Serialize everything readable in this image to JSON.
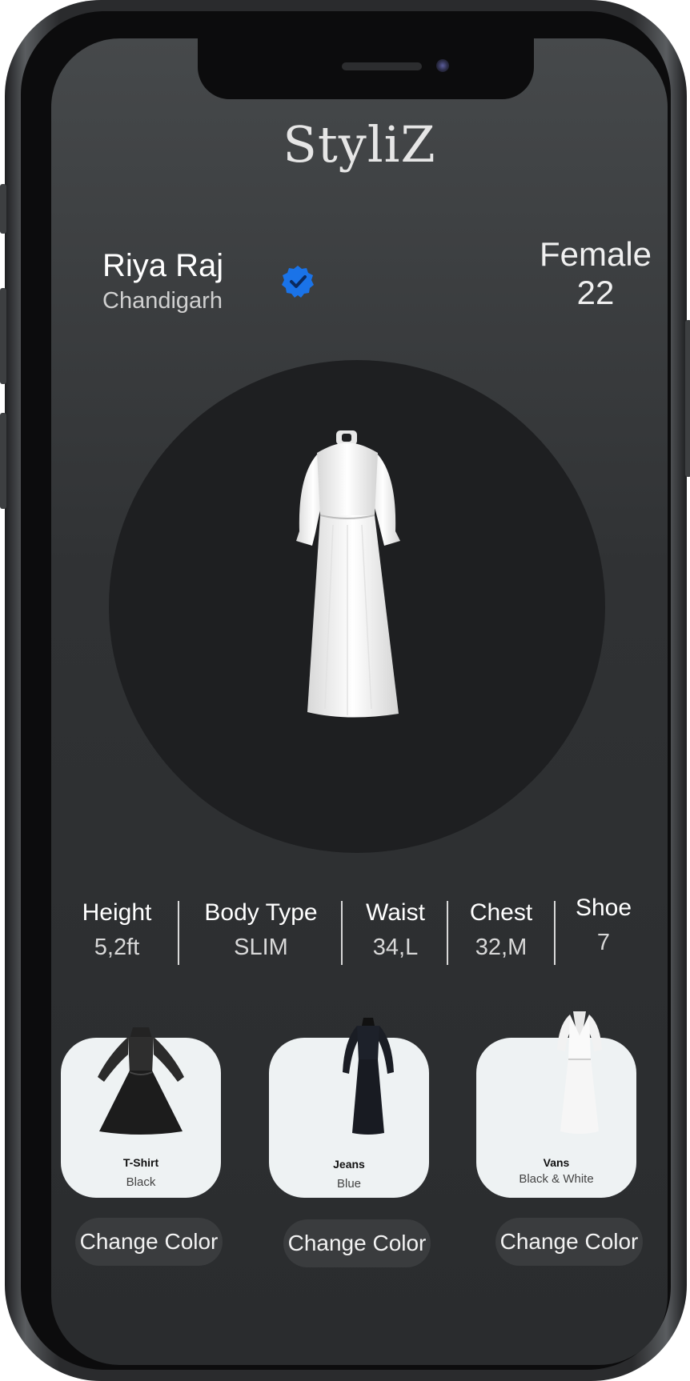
{
  "app": {
    "brand": "StyliZ"
  },
  "profile": {
    "name": "Riya Raj",
    "city": "Chandigarh",
    "verified_icon": "verified-badge-icon",
    "gender": "Female",
    "age": "22"
  },
  "featured_item": {
    "icon": "white-dress-image"
  },
  "stats": [
    {
      "label": "Height",
      "value": "5,2ft"
    },
    {
      "label": "Body Type",
      "value": "SLIM"
    },
    {
      "label": "Waist",
      "value": "34,L"
    },
    {
      "label": "Chest",
      "value": "32,M"
    },
    {
      "label": "Shoe",
      "value": "7"
    }
  ],
  "items": [
    {
      "title": "T-Shirt",
      "subtitle": "Black",
      "button": "Change Color",
      "icon": "black-flared-dress-image"
    },
    {
      "title": "Jeans",
      "subtitle": "Blue",
      "button": "Change Color",
      "icon": "navy-dress-image"
    },
    {
      "title": "Vans",
      "subtitle": "Black & White",
      "button": "Change Color",
      "icon": "white-wrap-dress-image"
    }
  ],
  "colors": {
    "verified": "#1a73e8",
    "background": "#303234",
    "card": "#eef2f3"
  }
}
